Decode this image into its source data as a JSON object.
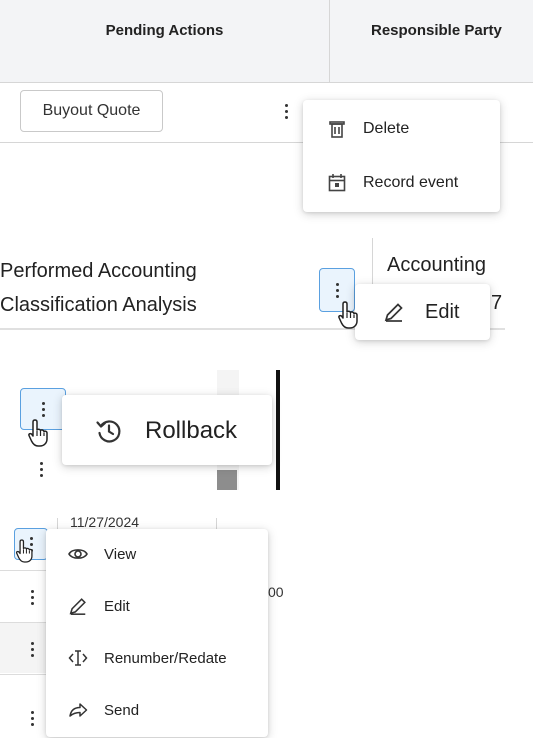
{
  "panel1": {
    "headers": [
      "Pending Actions",
      "Responsible Party"
    ],
    "buyout_button": "Buyout Quote",
    "menu": [
      {
        "label": "Delete",
        "icon": "trash-icon"
      },
      {
        "label": "Record event",
        "icon": "calendar-icon"
      }
    ]
  },
  "panel2": {
    "row_title_line1": "Performed Accounting",
    "row_title_line2": "Classification Analysis",
    "next_col_text": "Accounting",
    "partial_text": "7",
    "menu": [
      {
        "label": "Edit",
        "icon": "pencil-icon"
      }
    ]
  },
  "panel3": {
    "menu": [
      {
        "label": "Rollback",
        "icon": "history-icon"
      }
    ]
  },
  "panel4": {
    "date_text": "11/27/2024",
    "partial_text": "00",
    "menu": [
      {
        "label": "View",
        "icon": "eye-icon"
      },
      {
        "label": "Edit",
        "icon": "pencil-icon"
      },
      {
        "label": "Renumber/Redate",
        "icon": "text-cursor-icon"
      },
      {
        "label": "Send",
        "icon": "share-arrow-icon"
      }
    ]
  }
}
